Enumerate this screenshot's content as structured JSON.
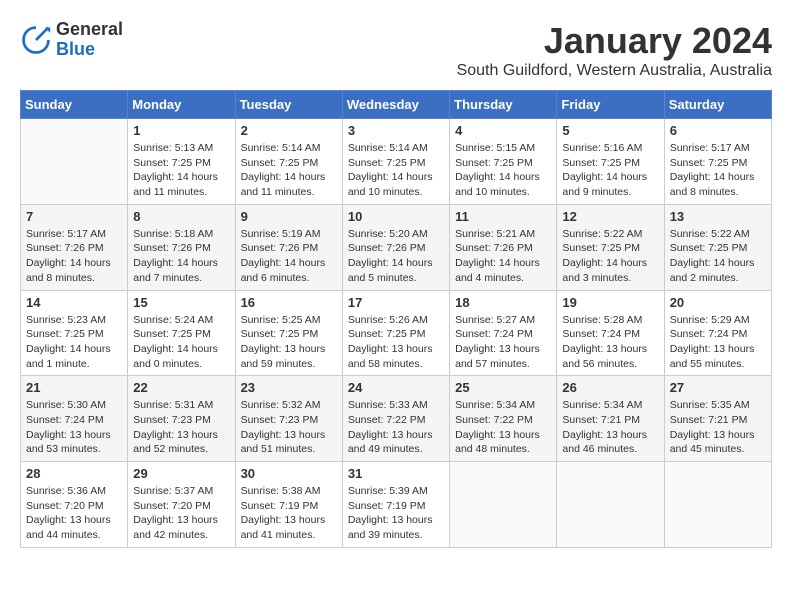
{
  "header": {
    "logo_general": "General",
    "logo_blue": "Blue",
    "title": "January 2024",
    "subtitle": "South Guildford, Western Australia, Australia"
  },
  "days_of_week": [
    "Sunday",
    "Monday",
    "Tuesday",
    "Wednesday",
    "Thursday",
    "Friday",
    "Saturday"
  ],
  "weeks": [
    [
      {
        "day": "",
        "info": ""
      },
      {
        "day": "1",
        "info": "Sunrise: 5:13 AM\nSunset: 7:25 PM\nDaylight: 14 hours\nand 11 minutes."
      },
      {
        "day": "2",
        "info": "Sunrise: 5:14 AM\nSunset: 7:25 PM\nDaylight: 14 hours\nand 11 minutes."
      },
      {
        "day": "3",
        "info": "Sunrise: 5:14 AM\nSunset: 7:25 PM\nDaylight: 14 hours\nand 10 minutes."
      },
      {
        "day": "4",
        "info": "Sunrise: 5:15 AM\nSunset: 7:25 PM\nDaylight: 14 hours\nand 10 minutes."
      },
      {
        "day": "5",
        "info": "Sunrise: 5:16 AM\nSunset: 7:25 PM\nDaylight: 14 hours\nand 9 minutes."
      },
      {
        "day": "6",
        "info": "Sunrise: 5:17 AM\nSunset: 7:25 PM\nDaylight: 14 hours\nand 8 minutes."
      }
    ],
    [
      {
        "day": "7",
        "info": "Sunrise: 5:17 AM\nSunset: 7:26 PM\nDaylight: 14 hours\nand 8 minutes."
      },
      {
        "day": "8",
        "info": "Sunrise: 5:18 AM\nSunset: 7:26 PM\nDaylight: 14 hours\nand 7 minutes."
      },
      {
        "day": "9",
        "info": "Sunrise: 5:19 AM\nSunset: 7:26 PM\nDaylight: 14 hours\nand 6 minutes."
      },
      {
        "day": "10",
        "info": "Sunrise: 5:20 AM\nSunset: 7:26 PM\nDaylight: 14 hours\nand 5 minutes."
      },
      {
        "day": "11",
        "info": "Sunrise: 5:21 AM\nSunset: 7:26 PM\nDaylight: 14 hours\nand 4 minutes."
      },
      {
        "day": "12",
        "info": "Sunrise: 5:22 AM\nSunset: 7:25 PM\nDaylight: 14 hours\nand 3 minutes."
      },
      {
        "day": "13",
        "info": "Sunrise: 5:22 AM\nSunset: 7:25 PM\nDaylight: 14 hours\nand 2 minutes."
      }
    ],
    [
      {
        "day": "14",
        "info": "Sunrise: 5:23 AM\nSunset: 7:25 PM\nDaylight: 14 hours\nand 1 minute."
      },
      {
        "day": "15",
        "info": "Sunrise: 5:24 AM\nSunset: 7:25 PM\nDaylight: 14 hours\nand 0 minutes."
      },
      {
        "day": "16",
        "info": "Sunrise: 5:25 AM\nSunset: 7:25 PM\nDaylight: 13 hours\nand 59 minutes."
      },
      {
        "day": "17",
        "info": "Sunrise: 5:26 AM\nSunset: 7:25 PM\nDaylight: 13 hours\nand 58 minutes."
      },
      {
        "day": "18",
        "info": "Sunrise: 5:27 AM\nSunset: 7:24 PM\nDaylight: 13 hours\nand 57 minutes."
      },
      {
        "day": "19",
        "info": "Sunrise: 5:28 AM\nSunset: 7:24 PM\nDaylight: 13 hours\nand 56 minutes."
      },
      {
        "day": "20",
        "info": "Sunrise: 5:29 AM\nSunset: 7:24 PM\nDaylight: 13 hours\nand 55 minutes."
      }
    ],
    [
      {
        "day": "21",
        "info": "Sunrise: 5:30 AM\nSunset: 7:24 PM\nDaylight: 13 hours\nand 53 minutes."
      },
      {
        "day": "22",
        "info": "Sunrise: 5:31 AM\nSunset: 7:23 PM\nDaylight: 13 hours\nand 52 minutes."
      },
      {
        "day": "23",
        "info": "Sunrise: 5:32 AM\nSunset: 7:23 PM\nDaylight: 13 hours\nand 51 minutes."
      },
      {
        "day": "24",
        "info": "Sunrise: 5:33 AM\nSunset: 7:22 PM\nDaylight: 13 hours\nand 49 minutes."
      },
      {
        "day": "25",
        "info": "Sunrise: 5:34 AM\nSunset: 7:22 PM\nDaylight: 13 hours\nand 48 minutes."
      },
      {
        "day": "26",
        "info": "Sunrise: 5:34 AM\nSunset: 7:21 PM\nDaylight: 13 hours\nand 46 minutes."
      },
      {
        "day": "27",
        "info": "Sunrise: 5:35 AM\nSunset: 7:21 PM\nDaylight: 13 hours\nand 45 minutes."
      }
    ],
    [
      {
        "day": "28",
        "info": "Sunrise: 5:36 AM\nSunset: 7:20 PM\nDaylight: 13 hours\nand 44 minutes."
      },
      {
        "day": "29",
        "info": "Sunrise: 5:37 AM\nSunset: 7:20 PM\nDaylight: 13 hours\nand 42 minutes."
      },
      {
        "day": "30",
        "info": "Sunrise: 5:38 AM\nSunset: 7:19 PM\nDaylight: 13 hours\nand 41 minutes."
      },
      {
        "day": "31",
        "info": "Sunrise: 5:39 AM\nSunset: 7:19 PM\nDaylight: 13 hours\nand 39 minutes."
      },
      {
        "day": "",
        "info": ""
      },
      {
        "day": "",
        "info": ""
      },
      {
        "day": "",
        "info": ""
      }
    ]
  ]
}
